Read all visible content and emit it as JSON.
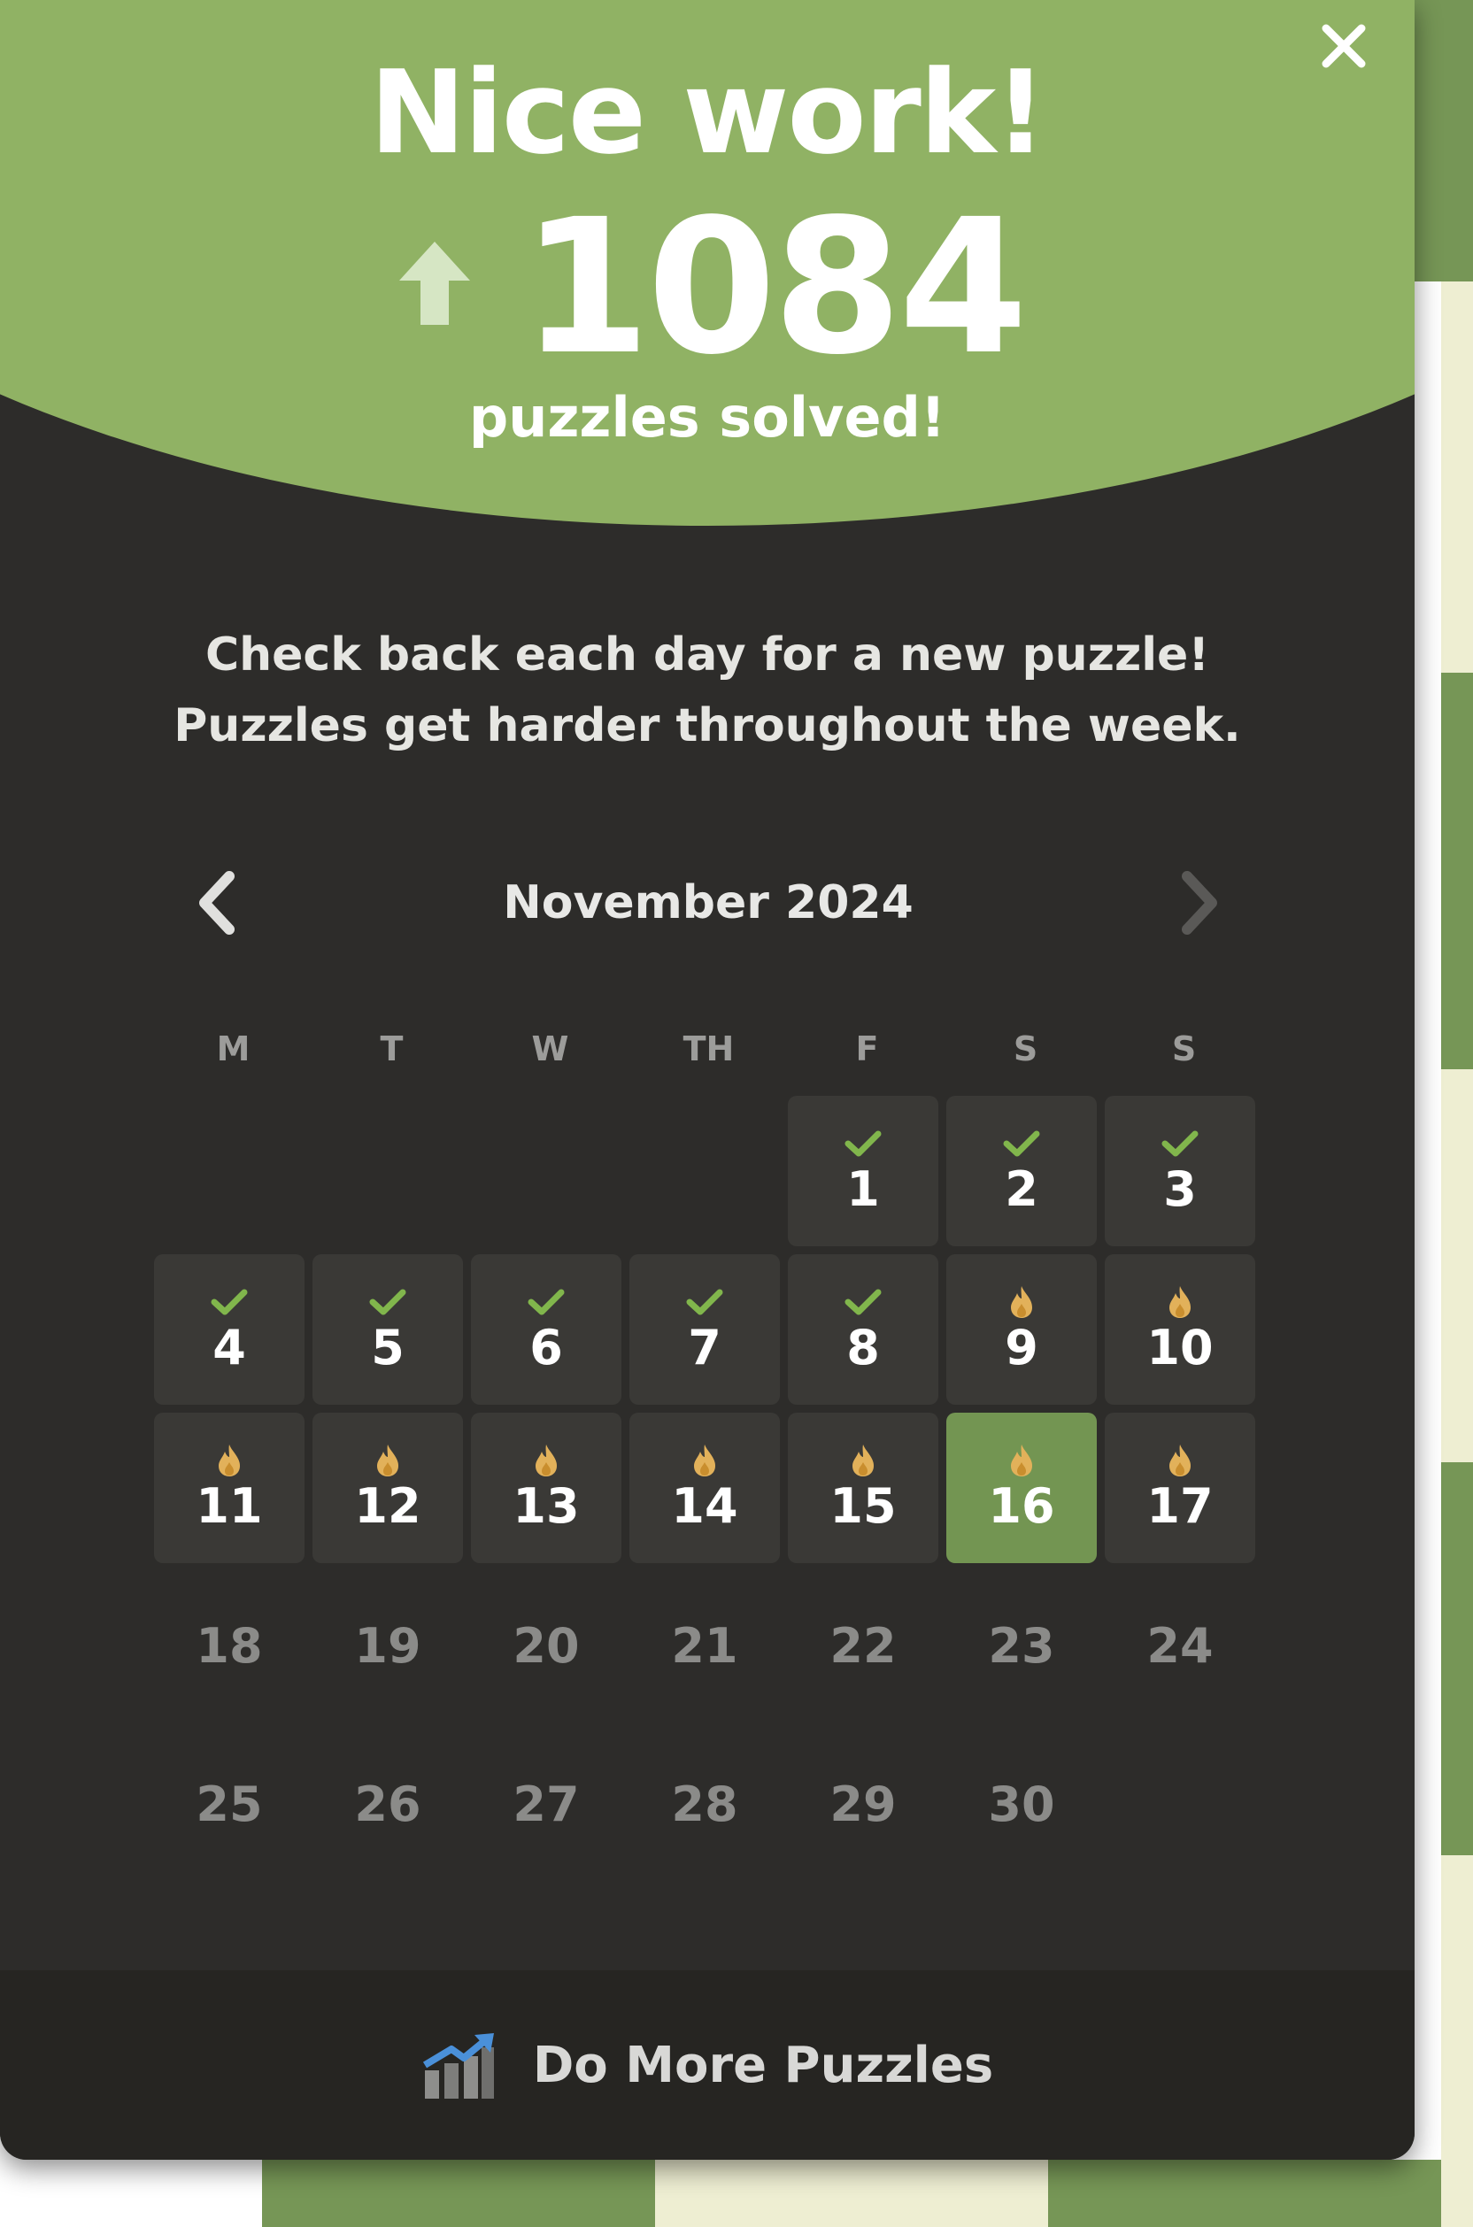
{
  "header": {
    "title": "Nice work!",
    "count": "1084",
    "count_label": "puzzles solved!",
    "accent_color": "#90b264"
  },
  "message": {
    "line1": "Check back each day for a new puzzle!",
    "line2": "Puzzles get harder throughout the week."
  },
  "calendar": {
    "month_label": "November 2024",
    "weekdays": [
      "M",
      "T",
      "W",
      "TH",
      "F",
      "S",
      "S"
    ],
    "leading_blanks": 4,
    "days": [
      {
        "day": "1",
        "status": "solved"
      },
      {
        "day": "2",
        "status": "solved"
      },
      {
        "day": "3",
        "status": "solved"
      },
      {
        "day": "4",
        "status": "solved"
      },
      {
        "day": "5",
        "status": "solved"
      },
      {
        "day": "6",
        "status": "solved"
      },
      {
        "day": "7",
        "status": "solved"
      },
      {
        "day": "8",
        "status": "solved"
      },
      {
        "day": "9",
        "status": "streak"
      },
      {
        "day": "10",
        "status": "streak"
      },
      {
        "day": "11",
        "status": "streak"
      },
      {
        "day": "12",
        "status": "streak"
      },
      {
        "day": "13",
        "status": "streak"
      },
      {
        "day": "14",
        "status": "streak"
      },
      {
        "day": "15",
        "status": "streak"
      },
      {
        "day": "16",
        "status": "today"
      },
      {
        "day": "17",
        "status": "streak"
      },
      {
        "day": "18",
        "status": "future"
      },
      {
        "day": "19",
        "status": "future"
      },
      {
        "day": "20",
        "status": "future"
      },
      {
        "day": "21",
        "status": "future"
      },
      {
        "day": "22",
        "status": "future"
      },
      {
        "day": "23",
        "status": "future"
      },
      {
        "day": "24",
        "status": "future"
      },
      {
        "day": "25",
        "status": "future"
      },
      {
        "day": "26",
        "status": "future"
      },
      {
        "day": "27",
        "status": "future"
      },
      {
        "day": "28",
        "status": "future"
      },
      {
        "day": "29",
        "status": "future"
      },
      {
        "day": "30",
        "status": "future"
      }
    ],
    "icons": {
      "solved": "check-icon",
      "streak": "flame-icon",
      "today": "flame-icon"
    },
    "colors": {
      "check": "#81b64c",
      "flame": "#e2b15a",
      "today_bg": "#739552"
    }
  },
  "footer": {
    "label": "Do More Puzzles",
    "icon": "chart-up-icon"
  },
  "close_icon": "close-icon",
  "prev_icon": "chevron-left-icon",
  "next_icon": "chevron-right-icon",
  "up_icon": "arrow-up-icon"
}
